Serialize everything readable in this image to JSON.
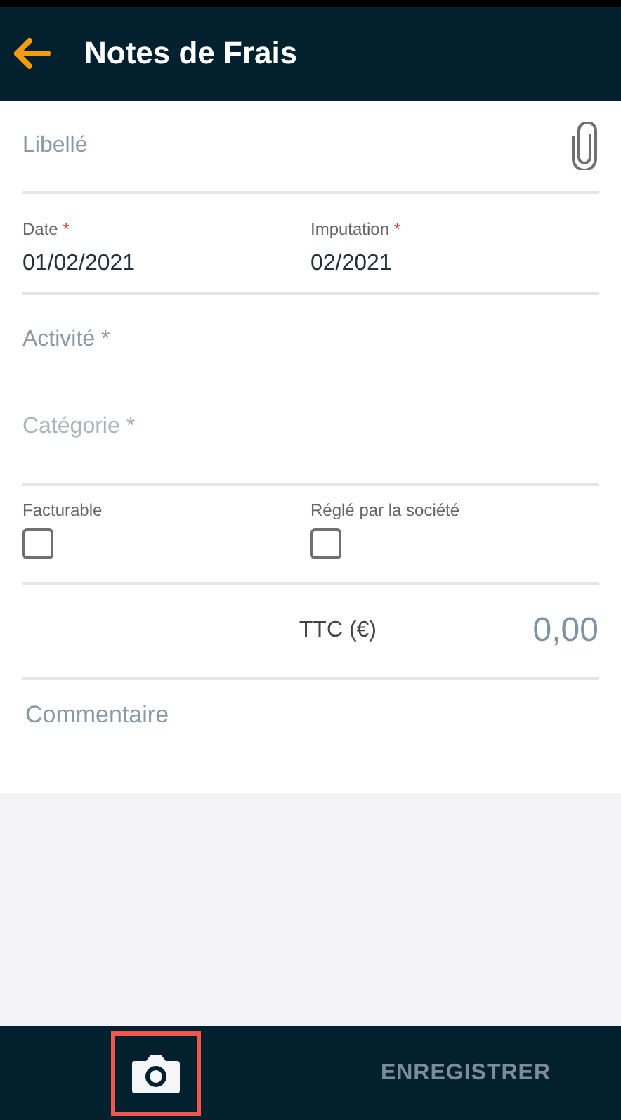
{
  "header": {
    "title": "Notes de Frais"
  },
  "label_field": {
    "placeholder": "Libellé"
  },
  "dates": [
    {
      "label": "Date",
      "required_mark": "*",
      "value": "01/02/2021"
    },
    {
      "label": "Imputation",
      "required_mark": "*",
      "value": "02/2021"
    }
  ],
  "selects": [
    {
      "placeholder": "Activité *",
      "disabled": false
    },
    {
      "placeholder": "Catégorie *",
      "disabled": true
    }
  ],
  "checkboxes": [
    {
      "label": "Facturable",
      "checked": false
    },
    {
      "label": "Réglé par la société",
      "checked": false
    }
  ],
  "amount": {
    "label": "TTC (€)",
    "placeholder": "0,00"
  },
  "comment": {
    "placeholder": "Commentaire"
  },
  "footer": {
    "camera_highlighted": true,
    "save_label": "ENREGISTRER"
  }
}
